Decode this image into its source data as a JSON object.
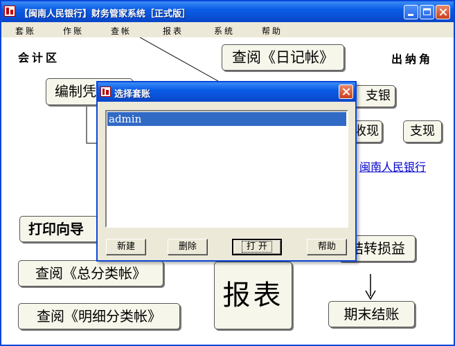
{
  "window": {
    "title": "【闽南人民银行】财务管家系统［正式版］"
  },
  "menu": [
    "套账",
    "作账",
    "查帐",
    "报表",
    "系统",
    "帮助"
  ],
  "canvas": {
    "left_area_label": "会计区",
    "right_area_label": "出纳角",
    "nodes": {
      "view_journal": "查阅《日记帐》",
      "edit_voucher": "编制凭证",
      "print_wizard": "打印向导",
      "view_general_ledger": "查阅《总分类帐》",
      "view_detail_ledger": "查阅《明细分类帐》",
      "reports": "报表",
      "bank_payment": "支银",
      "cash_receipt": "收现",
      "cash_payment": "支现",
      "transfer_pl": "结转损益",
      "period_close": "期末结账"
    },
    "bank_link": "闽南人民银行"
  },
  "dialog": {
    "title": "选择套账",
    "items": [
      "admin"
    ],
    "buttons": {
      "new": "新建",
      "delete": "删除",
      "open": "打 开",
      "help": "帮助"
    }
  },
  "colors": {
    "titlebar": "#0a5ce5",
    "selection": "#316ac5",
    "link": "#0000cc"
  }
}
